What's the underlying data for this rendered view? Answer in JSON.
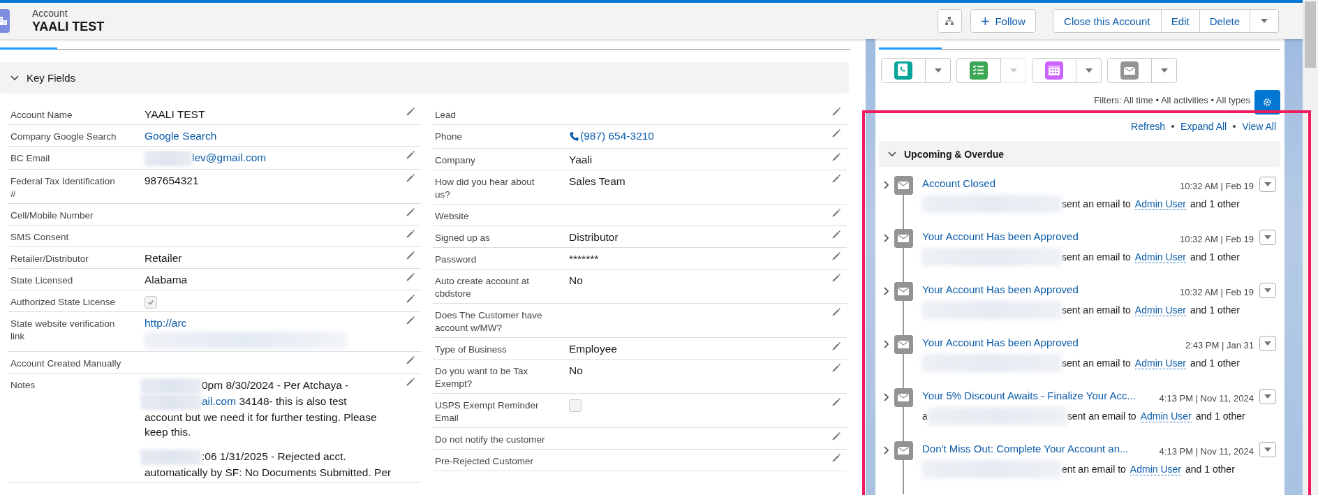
{
  "header": {
    "object_label": "Account",
    "title": "YAALI TEST",
    "follow_label": "Follow",
    "actions": [
      "Close this Account",
      "Edit",
      "Delete"
    ]
  },
  "section": {
    "title": "Key Fields",
    "expanded": true
  },
  "left_fields": [
    {
      "label": "Account Name",
      "kind": "text",
      "value": "YAALI TEST",
      "editable": true
    },
    {
      "label": "Company Google Search",
      "kind": "link",
      "value": "Google Search",
      "editable": false
    },
    {
      "label": "BC Email",
      "kind": "redacted_link",
      "value": "lev@gmail.com",
      "editable": true
    },
    {
      "label": "Federal Tax Identification #",
      "kind": "text",
      "value": "987654321",
      "editable": true
    },
    {
      "label": "Cell/Mobile Number",
      "kind": "empty",
      "editable": true
    },
    {
      "label": "SMS Consent",
      "kind": "empty",
      "editable": true
    },
    {
      "label": "Retailer/Distributor",
      "kind": "text",
      "value": "Retailer",
      "editable": true
    },
    {
      "label": "State Licensed",
      "kind": "text",
      "value": "Alabama",
      "editable": true
    },
    {
      "label": "Authorized State License",
      "kind": "checkbox",
      "checked": true,
      "editable": true
    },
    {
      "label": "State website verification link",
      "kind": "link_blurred",
      "value": "http://arc",
      "editable": true
    },
    {
      "label": "Account Created Manually",
      "kind": "empty",
      "editable": true
    },
    {
      "label": "Notes",
      "kind": "notes",
      "editable": true,
      "paragraphs": [
        {
          "lines": [
            {
              "redacted": true,
              "text": "0pm 8/30/2024 - Per Atchaya -"
            },
            {
              "redacted": true,
              "link": "ail.com",
              "text": " 34148- this is also test"
            },
            {
              "redacted": false,
              "text": "account but we need it for further testing. Please"
            },
            {
              "redacted": false,
              "text": "keep this."
            }
          ]
        },
        {
          "lines": [
            {
              "redacted": true,
              "text": ":06 1/31/2025 - Rejected acct."
            },
            {
              "redacted": false,
              "text": "automatically by SF: No Documents Submitted. Per"
            }
          ]
        }
      ]
    }
  ],
  "right_fields": [
    {
      "label": "Lead",
      "kind": "empty",
      "editable": true
    },
    {
      "label": "Phone",
      "kind": "phone",
      "value": "(987) 654-3210",
      "editable": true
    },
    {
      "label": "Company",
      "kind": "text",
      "value": "Yaali",
      "editable": true
    },
    {
      "label": "How did you hear about us?",
      "kind": "text",
      "value": "Sales Team",
      "editable": true
    },
    {
      "label": "Website",
      "kind": "empty",
      "editable": true
    },
    {
      "label": "Signed up as",
      "kind": "text",
      "value": "Distributor",
      "editable": true
    },
    {
      "label": "Password",
      "kind": "text",
      "value": "*******",
      "editable": true
    },
    {
      "label": "Auto create account at cbdstore",
      "kind": "text",
      "value": "No",
      "editable": true
    },
    {
      "label": "Does The Customer have account w/MW?",
      "kind": "empty",
      "editable": true
    },
    {
      "label": "Type of Business",
      "kind": "text",
      "value": "Employee",
      "editable": true
    },
    {
      "label": "Do you want to be Tax Exempt?",
      "kind": "text",
      "value": "No",
      "editable": true
    },
    {
      "label": "USPS Exempt Reminder Email",
      "kind": "checkbox",
      "checked": false,
      "editable": true
    },
    {
      "label": "Do not notify the customer",
      "kind": "empty",
      "editable": true
    },
    {
      "label": "Pre-Rejected Customer",
      "kind": "empty",
      "editable": true
    }
  ],
  "activity": {
    "tools": [
      {
        "kind": "call",
        "color": "#06a59a",
        "dropdown_disabled": false
      },
      {
        "kind": "task",
        "color": "#3ba755",
        "dropdown_disabled": true
      },
      {
        "kind": "event",
        "color": "#cb65ff",
        "dropdown_disabled": false
      },
      {
        "kind": "email",
        "color": "#939393",
        "dropdown_disabled": false
      }
    ],
    "filters": "Filters: All time • All activities • All types",
    "links": [
      "Refresh",
      "Expand All",
      "View All"
    ],
    "group": {
      "title": "Upcoming & Overdue",
      "expanded": true
    },
    "items": [
      {
        "title": "Account Closed",
        "time": "10:32 AM | Feb 19",
        "verb": "sent an email to",
        "recipient": "Admin User",
        "rest": "and 1 other",
        "expanded": false
      },
      {
        "title": "Your Account Has been Approved",
        "time": "10:32 AM | Feb 19",
        "verb": "sent an email to",
        "recipient": "Admin User",
        "rest": "and 1 other",
        "expanded": false
      },
      {
        "title": "Your Account Has been Approved",
        "time": "10:32 AM | Feb 19",
        "verb": "sent an email to",
        "recipient": "Admin User",
        "rest": "and 1 other",
        "expanded": false
      },
      {
        "title": "Your Account Has been Approved",
        "time": "2:43 PM | Jan 31",
        "verb": "sent an email to",
        "recipient": "Admin User",
        "rest": "and 1 other",
        "expanded": false
      },
      {
        "title": "Your 5% Discount Awaits - Finalize Your Acc...",
        "time": "4:13 PM | Nov 11, 2024",
        "lead": "a",
        "verb": "sent an email to",
        "recipient": "Admin User",
        "rest": "and 1 other",
        "expanded": false
      },
      {
        "title": "Don't Miss Out: Complete Your Account an...",
        "time": "4:13 PM | Nov 11, 2024",
        "verb": "ent an email to",
        "recipient": "Admin User",
        "rest": "and 1 other",
        "expanded": false
      }
    ]
  }
}
